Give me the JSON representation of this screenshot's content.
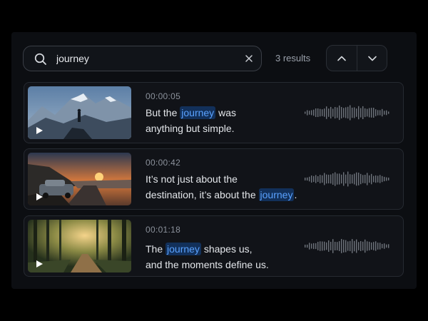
{
  "search": {
    "query": "journey",
    "results_label": "3 results"
  },
  "icons": {
    "search": "search-icon",
    "clear": "close-icon",
    "prev": "chevron-up-icon",
    "next": "chevron-down-icon",
    "play": "play-icon",
    "waveform": "waveform-icon"
  },
  "colors": {
    "highlight_bg": "#12305a",
    "highlight_text": "#5aa2ff"
  },
  "results": [
    {
      "timestamp": "00:00:05",
      "line1": {
        "before": "But the ",
        "match": "journey",
        "after": " was"
      },
      "line2": {
        "before": "anything but simple.",
        "match": "",
        "after": ""
      },
      "thumbnail": "mountain-hiker"
    },
    {
      "timestamp": "00:00:42",
      "line1": {
        "before": "It’s not just about the",
        "match": "",
        "after": ""
      },
      "line2": {
        "before": "destination, it’s about the ",
        "match": "journey",
        "after": "."
      },
      "thumbnail": "car-sunset-road"
    },
    {
      "timestamp": "00:01:18",
      "line1": {
        "before": "The ",
        "match": "journey",
        "after": " shapes us,"
      },
      "line2": {
        "before": "and the moments define us.",
        "match": "",
        "after": ""
      },
      "thumbnail": "forest-path"
    }
  ]
}
